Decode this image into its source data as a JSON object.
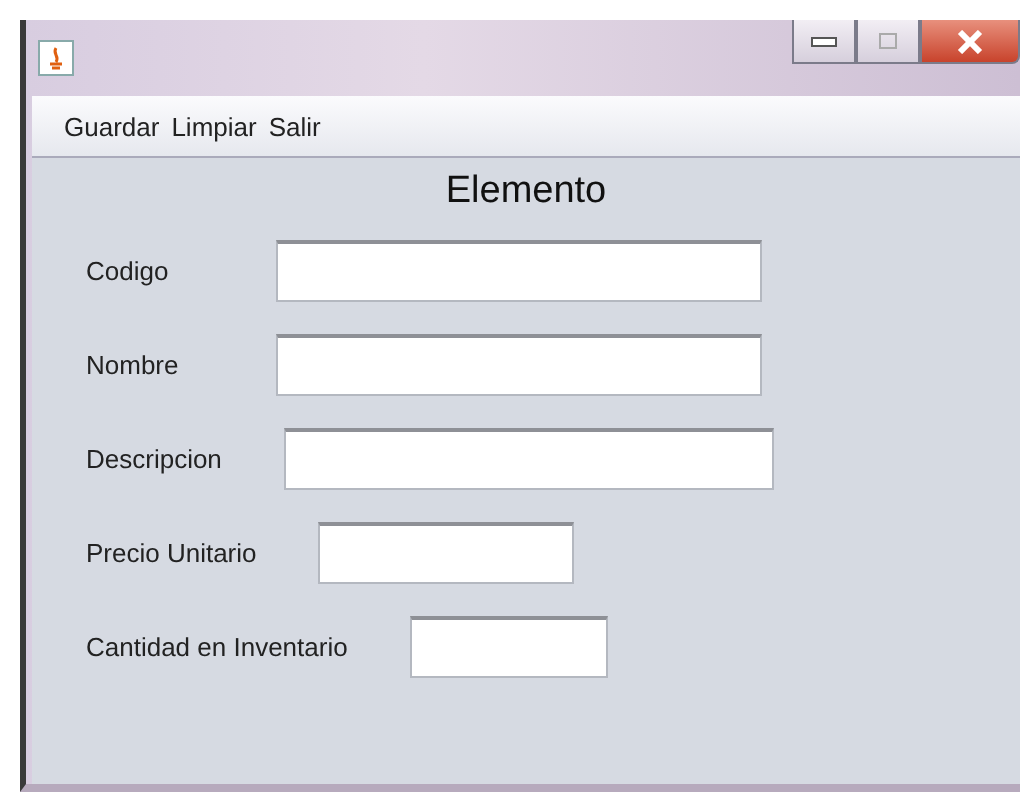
{
  "menu": [
    "Guardar",
    "Limpiar",
    "Salir"
  ],
  "form": {
    "title": "Elemento",
    "fields": [
      {
        "label": "Codigo"
      },
      {
        "label": "Nombre"
      },
      {
        "label": "Descripcion"
      },
      {
        "label": "Precio Unitario"
      },
      {
        "label": "Cantidad en Inventario"
      }
    ]
  }
}
